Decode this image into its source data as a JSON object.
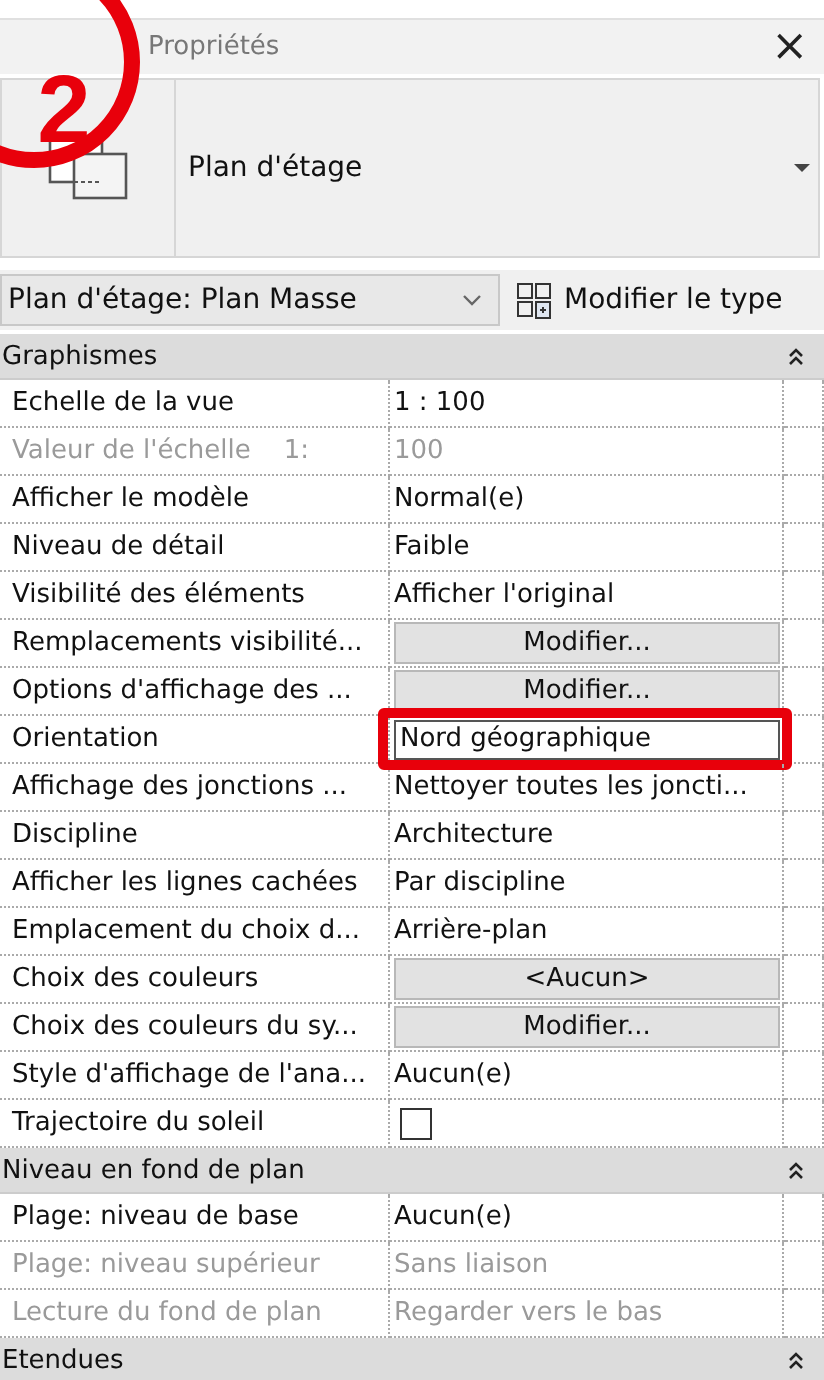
{
  "annotation": {
    "label": "2"
  },
  "window": {
    "title": "Propriétés",
    "close": "×"
  },
  "type_selector": {
    "label": "Plan d'étage"
  },
  "view_selector": {
    "value": "Plan d'étage: Plan Masse"
  },
  "edit_type_button": {
    "label": "Modifier le type"
  },
  "sections": [
    {
      "title": "Graphismes",
      "expanded": true,
      "rows": [
        {
          "label": "Echelle de la vue",
          "value": "1 : 100",
          "kind": "text",
          "disabled": false,
          "highlighted": false
        },
        {
          "label": "Valeur de l'échelle    1:",
          "value": "100",
          "kind": "text",
          "disabled": true,
          "highlighted": false
        },
        {
          "label": "Afficher le modèle",
          "value": "Normal(e)",
          "kind": "text",
          "disabled": false,
          "highlighted": false
        },
        {
          "label": "Niveau de détail",
          "value": "Faible",
          "kind": "text",
          "disabled": false,
          "highlighted": false
        },
        {
          "label": "Visibilité des éléments",
          "value": "Afficher l'original",
          "kind": "text",
          "disabled": false,
          "highlighted": false
        },
        {
          "label": "Remplacements visibilité...",
          "value": "Modifier...",
          "kind": "button",
          "disabled": false,
          "highlighted": false
        },
        {
          "label": "Options d'affichage des ...",
          "value": "Modifier...",
          "kind": "button",
          "disabled": false,
          "highlighted": false
        },
        {
          "label": "Orientation",
          "value": "Nord géographique",
          "kind": "input",
          "disabled": false,
          "highlighted": true
        },
        {
          "label": "Affichage des jonctions ...",
          "value": "Nettoyer toutes les joncti...",
          "kind": "text",
          "disabled": false,
          "highlighted": false
        },
        {
          "label": "Discipline",
          "value": "Architecture",
          "kind": "text",
          "disabled": false,
          "highlighted": false
        },
        {
          "label": "Afficher les lignes cachées",
          "value": "Par discipline",
          "kind": "text",
          "disabled": false,
          "highlighted": false
        },
        {
          "label": "Emplacement du choix d...",
          "value": "Arrière-plan",
          "kind": "text",
          "disabled": false,
          "highlighted": false
        },
        {
          "label": "Choix des couleurs",
          "value": "<Aucun>",
          "kind": "button",
          "disabled": false,
          "highlighted": false
        },
        {
          "label": "Choix des couleurs du sy...",
          "value": "Modifier...",
          "kind": "button",
          "disabled": false,
          "highlighted": false
        },
        {
          "label": "Style d'affichage de l'ana...",
          "value": "Aucun(e)",
          "kind": "text",
          "disabled": false,
          "highlighted": false
        },
        {
          "label": "Trajectoire du soleil",
          "kind": "checkbox",
          "checked": false,
          "disabled": false,
          "highlighted": false
        }
      ]
    },
    {
      "title": "Niveau en fond de plan",
      "expanded": true,
      "rows": [
        {
          "label": "Plage: niveau de base",
          "value": "Aucun(e)",
          "kind": "text",
          "disabled": false,
          "highlighted": false
        },
        {
          "label": "Plage: niveau supérieur",
          "value": "Sans liaison",
          "kind": "text",
          "disabled": true,
          "highlighted": false
        },
        {
          "label": "Lecture du fond de plan",
          "value": "Regarder vers le bas",
          "kind": "text",
          "disabled": true,
          "highlighted": false
        }
      ]
    },
    {
      "title": "Etendues",
      "expanded": true
    }
  ]
}
